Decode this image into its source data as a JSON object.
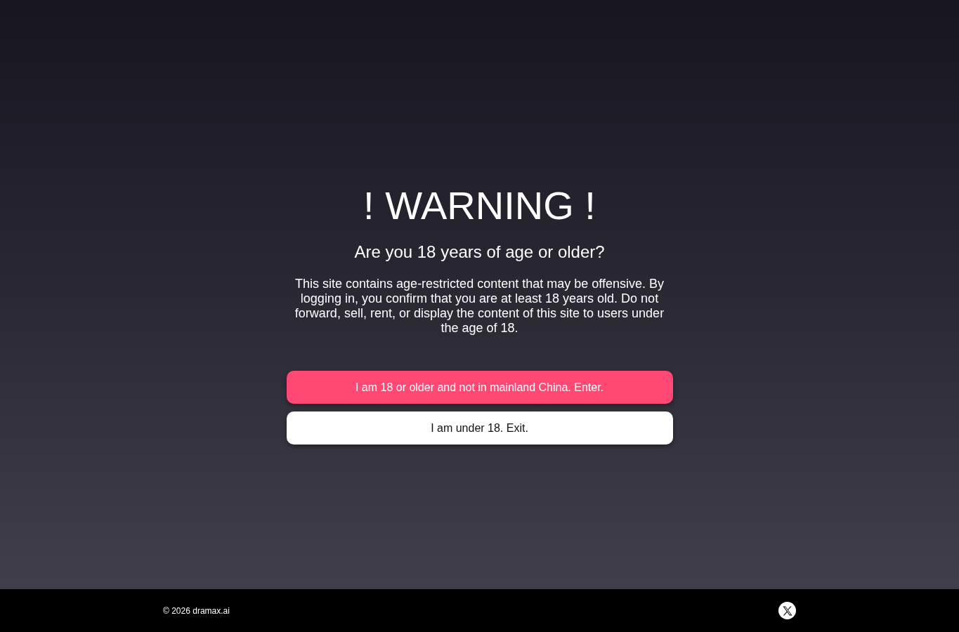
{
  "warning": {
    "title": "! WARNING !",
    "question": "Are you 18 years of age or older?",
    "message": "This site contains age-restricted content that may be offensive. By logging in, you confirm that you are at least 18 years old. Do not forward, sell, rent, or display the content of this site to users under the age of 18."
  },
  "buttons": [
    {
      "label": "I am 18 or older and not in mainland China. Enter.",
      "kind": "primary"
    },
    {
      "label": "I am under 18. Exit.",
      "kind": "secondary"
    }
  ],
  "footer": {
    "copyright": "© 2026 dramax.ai"
  }
}
